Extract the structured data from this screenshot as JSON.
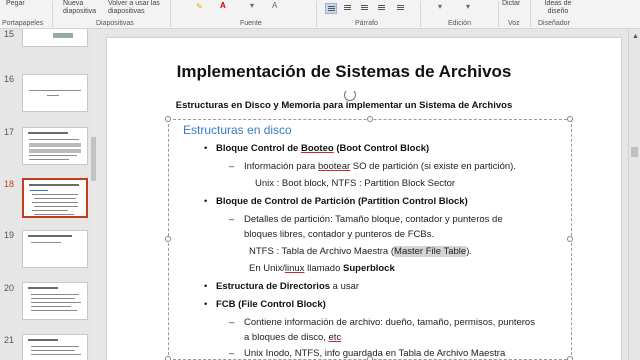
{
  "ribbon": {
    "top_labels": [
      "Pegar",
      "Nueva diapositiva",
      "Volver a usar las diapositivas",
      "Dictar",
      "Ideas de diseño"
    ],
    "groups": [
      "Portapapeles",
      "Diapositivas",
      "Fuente",
      "Párrafo",
      "Edición",
      "Voz",
      "Diseñador"
    ],
    "icons": [
      "highlight-icon",
      "font-color-icon",
      "align-left-icon",
      "align-center-icon",
      "align-right-icon",
      "justify-icon",
      "columns-icon",
      "microphone-icon",
      "designer-icon"
    ]
  },
  "thumbnails": [
    {
      "number": "15",
      "active": false
    },
    {
      "number": "16",
      "active": false
    },
    {
      "number": "17",
      "active": false
    },
    {
      "number": "18",
      "active": true
    },
    {
      "number": "19",
      "active": false
    },
    {
      "number": "20",
      "active": false
    },
    {
      "number": "21",
      "active": false
    }
  ],
  "slide": {
    "title": "Implementación de Sistemas de Archivos",
    "subtitle": "Estructuras en Disco y Memoria para implementar un Sistema de Archivos",
    "heading": "Estructuras en disco",
    "items": [
      {
        "type": "bullet",
        "bold": "Bloque Control de ",
        "bold_u": "Booteo",
        "tail_bold": " (Boot Control Block)"
      },
      {
        "type": "dash",
        "pre": "Información para ",
        "u": "bootear",
        "post": " SO de partición (si existe en partición)."
      },
      {
        "type": "plain",
        "text": "Unix : Boot block, NTFS : Partition Block Sector"
      },
      {
        "type": "bullet",
        "bold": "Bloque de Control de Partición (Partition Control Block)"
      },
      {
        "type": "dash",
        "text": "Detalles de partición: Tamaño bloque, contador y punteros de"
      },
      {
        "type": "plain",
        "text": "bloques libres, contador y punteros de FCBs."
      },
      {
        "type": "plain",
        "pre": "NTFS : Tabla de Archivo Maestra (",
        "hl": "Master File Table",
        "post": ")."
      },
      {
        "type": "plain",
        "pre": "En Unix/",
        "u": "linux",
        "mid": " llamado ",
        "bold": "Superblock"
      },
      {
        "type": "bullet",
        "bold": "Estructura de Directorios",
        "post": " a usar"
      },
      {
        "type": "bullet",
        "bold": "FCB (File Control Block)"
      },
      {
        "type": "dash",
        "text": "Contiene información de archivo: dueño, tamaño, permisos, punteros"
      },
      {
        "type": "plain",
        "pre": "a bloques de disco, ",
        "u": "etc"
      },
      {
        "type": "dash",
        "text": "Unix Inodo, NTFS, info guardada en Tabla de Archivo Maestra"
      }
    ]
  }
}
